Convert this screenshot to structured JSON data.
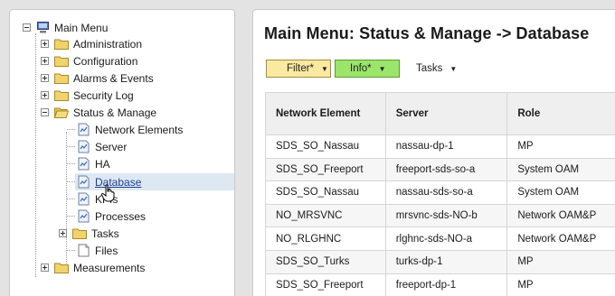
{
  "tree": {
    "root": "Main Menu",
    "items": [
      {
        "label": "Administration"
      },
      {
        "label": "Configuration"
      },
      {
        "label": "Alarms & Events"
      },
      {
        "label": "Security Log"
      },
      {
        "label": "Status & Manage"
      },
      {
        "label": "Network Elements"
      },
      {
        "label": "Server"
      },
      {
        "label": "HA"
      },
      {
        "label": "Database"
      },
      {
        "label": "KPIs"
      },
      {
        "label": "Processes"
      },
      {
        "label": "Tasks"
      },
      {
        "label": "Files"
      },
      {
        "label": "Measurements"
      }
    ],
    "selected": "Database"
  },
  "page": {
    "title": "Main Menu: Status & Manage -> Database"
  },
  "toolbar": {
    "filter_label": "Filter*",
    "info_label": "Info*",
    "tasks_label": "Tasks"
  },
  "table": {
    "headers": [
      "Network Element",
      "Server",
      "Role"
    ],
    "rows": [
      [
        "SDS_SO_Nassau",
        "nassau-dp-1",
        "MP"
      ],
      [
        "SDS_SO_Freeport",
        "freeport-sds-so-a",
        "System OAM"
      ],
      [
        "SDS_SO_Nassau",
        "nassau-sds-so-a",
        "System OAM"
      ],
      [
        "NO_MRSVNC",
        "mrsvnc-sds-NO-b",
        "Network OAM&P"
      ],
      [
        "NO_RLGHNC",
        "rlghnc-sds-NO-a",
        "Network OAM&P"
      ],
      [
        "SDS_SO_Turks",
        "turks-dp-1",
        "MP"
      ],
      [
        "SDS_SO_Freeport",
        "freeport-dp-1",
        "MP"
      ]
    ]
  },
  "colors": {
    "filter_bg": "#fae9a0",
    "info_bg": "#9be56a",
    "selected_row": "#dde8f3",
    "folder": "#f2d36b"
  }
}
